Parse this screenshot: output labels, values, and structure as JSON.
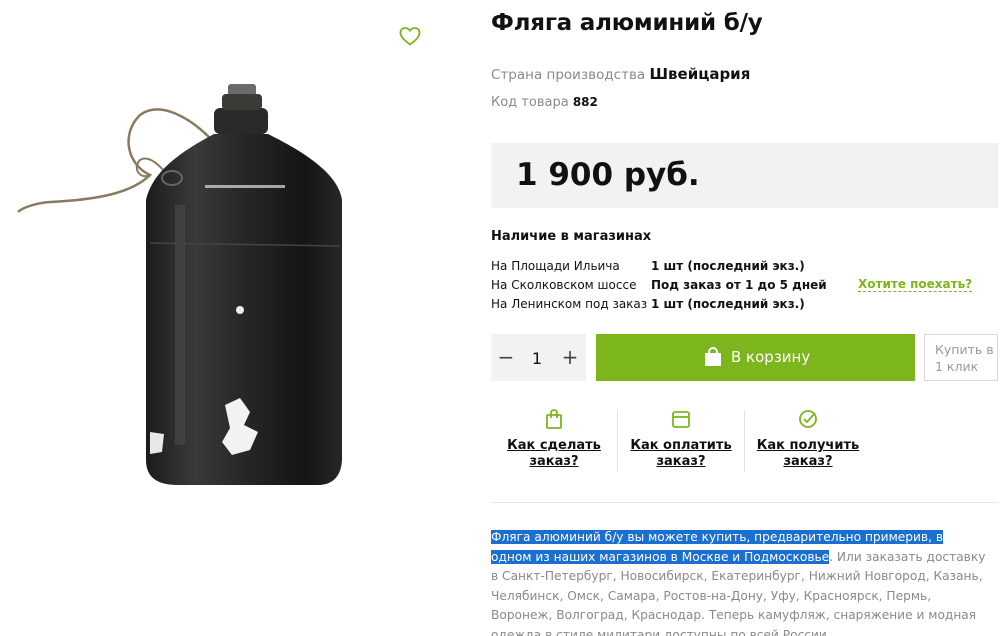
{
  "product": {
    "title": "Фляга алюминий б/у",
    "country_label": "Страна производства",
    "country_value": "Швейцария",
    "code_label": "Код товара",
    "code_value": "882",
    "price": "1 900 руб."
  },
  "availability": {
    "title": "Наличие в магазинах",
    "stores": [
      {
        "name": "На Площади Ильича",
        "qty": "1 шт (последний экз.)"
      },
      {
        "name": "На Сколковском шоссе",
        "qty": "Под заказ от 1 до 5 дней"
      },
      {
        "name": "На Ленинском под заказ",
        "qty": "1 шт (последний экз.)"
      }
    ],
    "want_link": "Хотите поехать?"
  },
  "purchase": {
    "minus": "−",
    "quantity": "1",
    "plus": "+",
    "cart_label": "В корзину",
    "one_click": "Купить в 1 клик"
  },
  "faq": [
    {
      "label": "Как сделать заказ?",
      "icon": "shopping-bag-icon"
    },
    {
      "label": "Как оплатить заказ?",
      "icon": "wallet-icon"
    },
    {
      "label": "Как получить заказ?",
      "icon": "check-circle-icon"
    }
  ],
  "description": {
    "selected": "Фляга алюминий б/у вы можете купить, предварительно примерив, в одном из наших магазинов в Москве и Подмосковье",
    "rest": ". Или заказать доставку в Санкт-Петербург, Новосибирск, Екатеринбург, Нижний Новгород, Казань, Челябинск, Омск, Самара, Ростов-на-Дону, Уфу, Красноярск, Пермь, Воронеж, Волгоград, Краснодар. Теперь камуфляж, снаряжение и модная одежда в стиле милитари доступны по всей России"
  },
  "colors": {
    "accent": "#7cb51c",
    "selection": "#1a6fd1",
    "price_bg": "#f2f2f2"
  }
}
